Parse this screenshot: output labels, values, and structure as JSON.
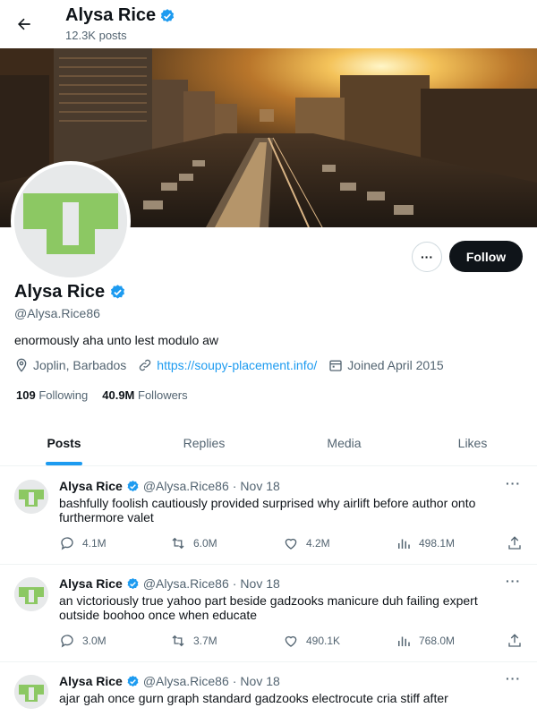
{
  "header": {
    "name": "Alysa Rice",
    "posts_count": "12.3K posts"
  },
  "profile": {
    "name": "Alysa Rice",
    "handle": "@Alysa.Rice86",
    "bio": "enormously aha unto lest modulo aw",
    "location": "Joplin, Barbados",
    "website": "https://soupy-placement.info/",
    "joined": "Joined April 2015",
    "following_count": "109",
    "following_label": "Following",
    "followers_count": "40.9M",
    "followers_label": "Followers",
    "follow_label": "Follow",
    "more_label": "···"
  },
  "tabs": [
    {
      "label": "Posts",
      "active": true
    },
    {
      "label": "Replies",
      "active": false
    },
    {
      "label": "Media",
      "active": false
    },
    {
      "label": "Likes",
      "active": false
    }
  ],
  "posts": [
    {
      "name": "Alysa Rice",
      "handle": "@Alysa.Rice86",
      "date": "Nov 18",
      "text": "bashfully foolish cautiously provided surprised why airlift before author onto furthermore valet",
      "replies": "4.1M",
      "reposts": "6.0M",
      "likes": "4.2M",
      "views": "498.1M"
    },
    {
      "name": "Alysa Rice",
      "handle": "@Alysa.Rice86",
      "date": "Nov 18",
      "text": "an victoriously true yahoo part beside gadzooks manicure duh failing expert outside boohoo once when educate",
      "replies": "3.0M",
      "reposts": "3.7M",
      "likes": "490.1K",
      "views": "768.0M"
    },
    {
      "name": "Alysa Rice",
      "handle": "@Alysa.Rice86",
      "date": "Nov 18",
      "text": "ajar gah once gurn graph standard gadzooks electrocute cria stiff after",
      "replies": "",
      "reposts": "",
      "likes": "",
      "views": ""
    }
  ],
  "colors": {
    "accent": "#1d9bf0",
    "avatar_green": "#8cc863",
    "text_primary": "#0f1419",
    "text_secondary": "#536471"
  },
  "icons": {
    "back": "arrow-left-icon",
    "verified": "verified-badge-icon",
    "location": "location-pin-icon",
    "link": "link-icon",
    "calendar": "calendar-icon",
    "reply": "reply-icon",
    "repost": "repost-icon",
    "like": "heart-icon",
    "views": "views-icon",
    "share": "share-icon"
  }
}
